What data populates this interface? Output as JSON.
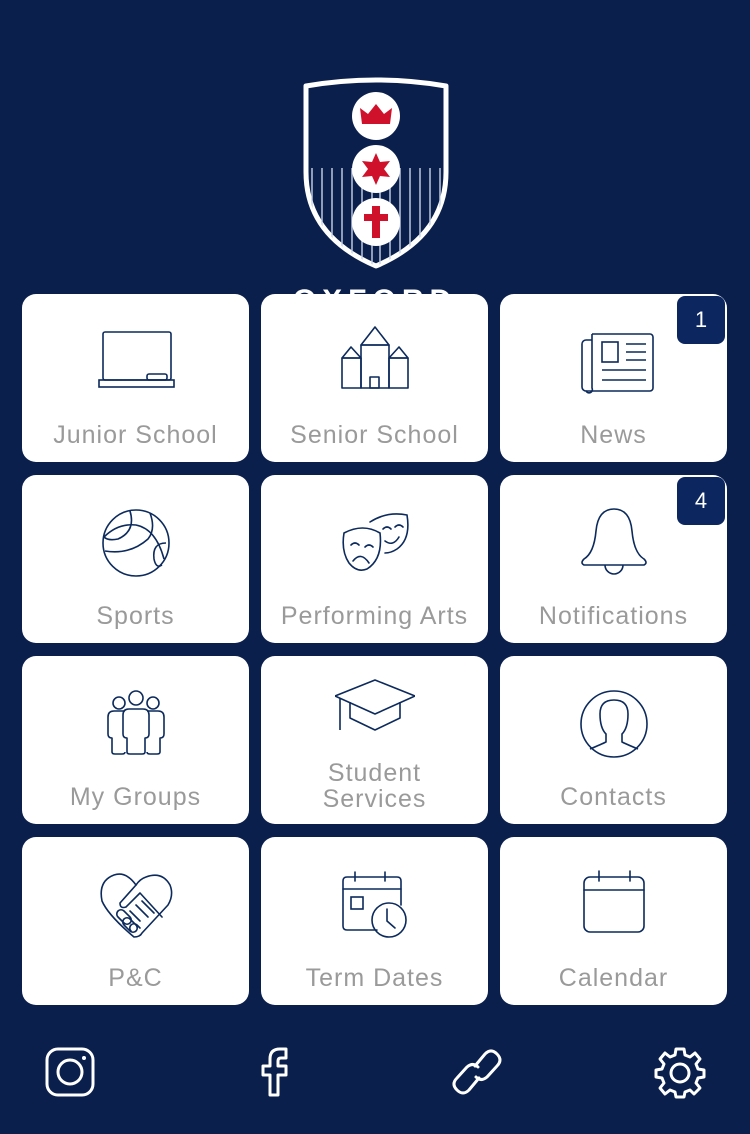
{
  "app": {
    "school_name": "OXFORD"
  },
  "colors": {
    "background": "#0a1f4c",
    "tile": "#ffffff",
    "icon_stroke": "#0c2a5c",
    "label": "#9a9a9a",
    "badge": "#0c2660",
    "crest_red": "#d0112b"
  },
  "tiles": [
    {
      "label": "Junior School",
      "icon": "chalkboard-icon"
    },
    {
      "label": "Senior School",
      "icon": "castle-building-icon"
    },
    {
      "label": "News",
      "icon": "newspaper-icon",
      "badge": "1"
    },
    {
      "label": "Sports",
      "icon": "ball-icon"
    },
    {
      "label": "Performing Arts",
      "icon": "theatre-masks-icon"
    },
    {
      "label": "Notifications",
      "icon": "bell-icon",
      "badge": "4"
    },
    {
      "label": "My Groups",
      "icon": "people-group-icon"
    },
    {
      "label_line1": "Student",
      "label_line2": "Services",
      "icon": "graduation-cap-icon"
    },
    {
      "label": "Contacts",
      "icon": "person-circle-icon"
    },
    {
      "label": "P&C",
      "icon": "heart-handshake-icon"
    },
    {
      "label": "Term Dates",
      "icon": "calendar-clock-icon"
    },
    {
      "label": "Calendar",
      "icon": "calendar-icon"
    }
  ],
  "bottom_bar": [
    {
      "icon": "instagram-icon"
    },
    {
      "icon": "facebook-icon"
    },
    {
      "icon": "link-icon"
    },
    {
      "icon": "settings-gear-icon"
    }
  ]
}
